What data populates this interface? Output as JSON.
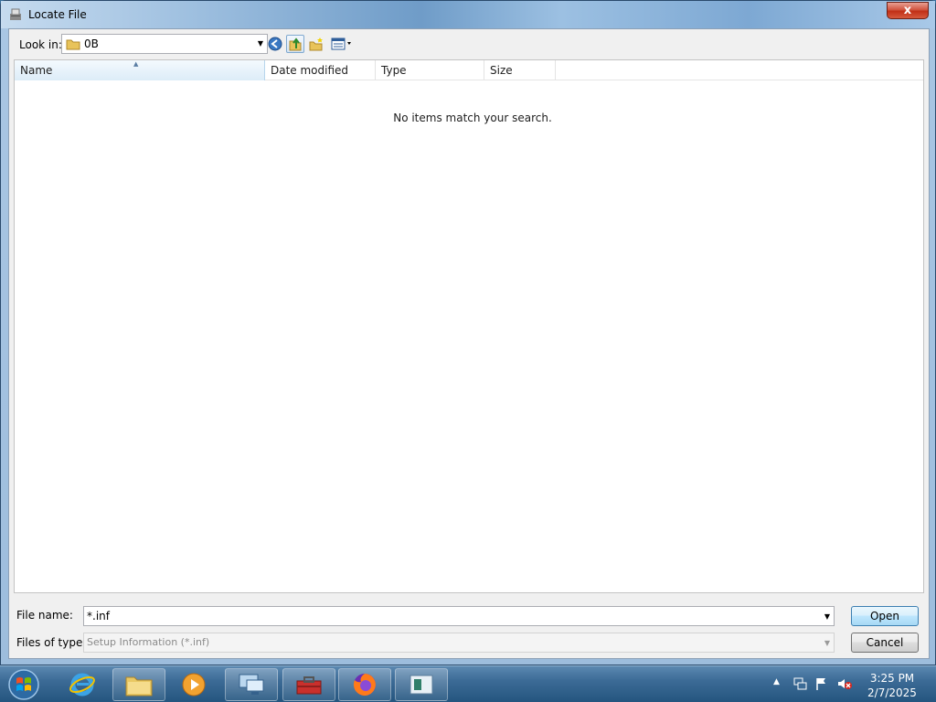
{
  "window": {
    "title": "Locate File",
    "close_label": "x"
  },
  "toolbar": {
    "look_in_label": "Look in:",
    "look_in_value": "0B"
  },
  "columns": {
    "name": "Name",
    "date": "Date modified",
    "type": "Type",
    "size": "Size"
  },
  "filelist": {
    "empty_message": "No items match your search."
  },
  "bottom": {
    "file_name_label": "File name:",
    "file_name_value": "*.inf",
    "files_of_type_label": "Files of type:",
    "files_of_type_value": "Setup Information (*.inf)",
    "open_label": "Open",
    "cancel_label": "Cancel"
  },
  "taskbar": {
    "items": [
      "windows-explorer",
      "media-player",
      "remote-desktop",
      "toolbox",
      "firefox",
      "app-window"
    ],
    "time": "3:25 PM",
    "date": "2/7/2025"
  },
  "colors": {
    "accent": "#3c7fb1",
    "close": "#c12f16",
    "taskbar": "#24557f"
  }
}
